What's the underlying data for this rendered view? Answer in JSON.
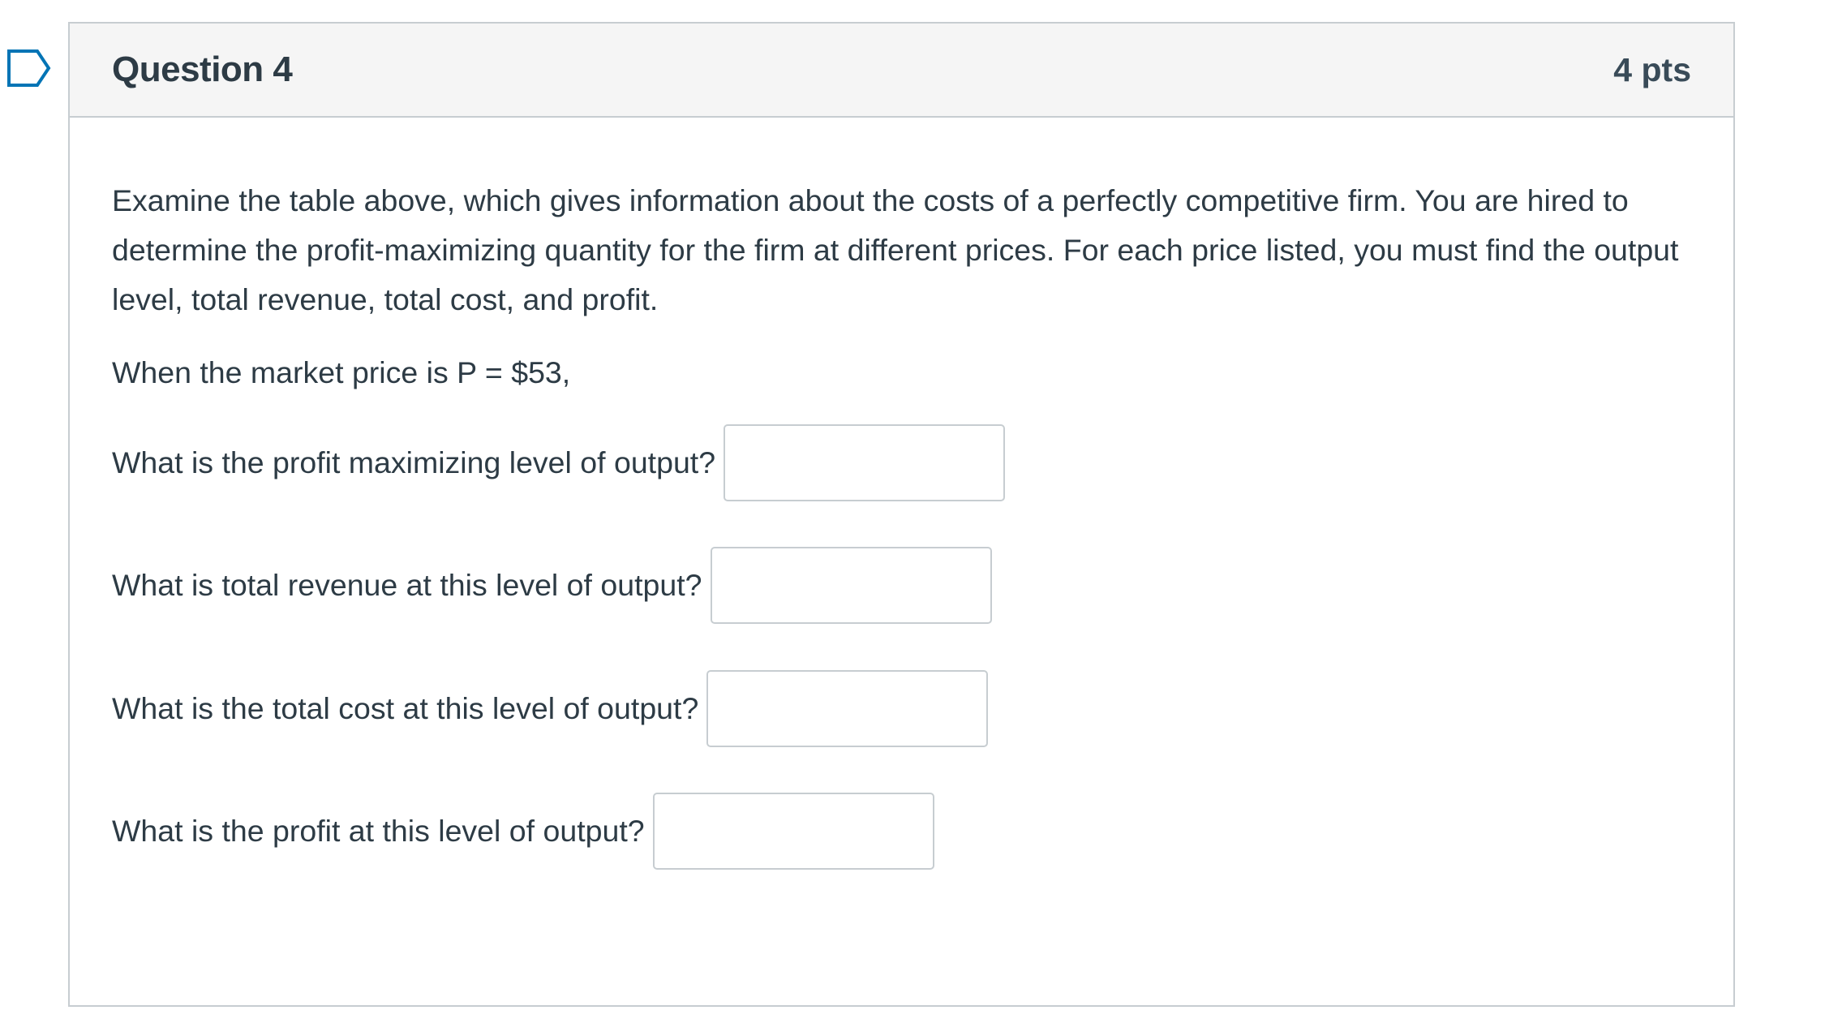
{
  "question": {
    "title": "Question 4",
    "points": "4 pts",
    "flag_icon": "bookmark-flag-icon",
    "prompt": "Examine the table above, which gives information about the costs of a perfectly competitive firm. You are hired to determine the profit-maximizing quantity for the firm at different prices. For each price listed, you must find the output level, total revenue, total cost, and profit.",
    "price_line": "When the market price is P = $53,",
    "items": [
      {
        "label": "What is the profit maximizing level of output?",
        "value": ""
      },
      {
        "label": "What is total revenue at this level of output?",
        "value": ""
      },
      {
        "label": "What is the total cost at this level of output?",
        "value": ""
      },
      {
        "label": "What is the profit at this level of output?",
        "value": ""
      }
    ]
  },
  "colors": {
    "header_bg": "#f5f5f5",
    "border": "#c7cdd1",
    "text": "#2d3b45",
    "flag": "#0374b5"
  }
}
